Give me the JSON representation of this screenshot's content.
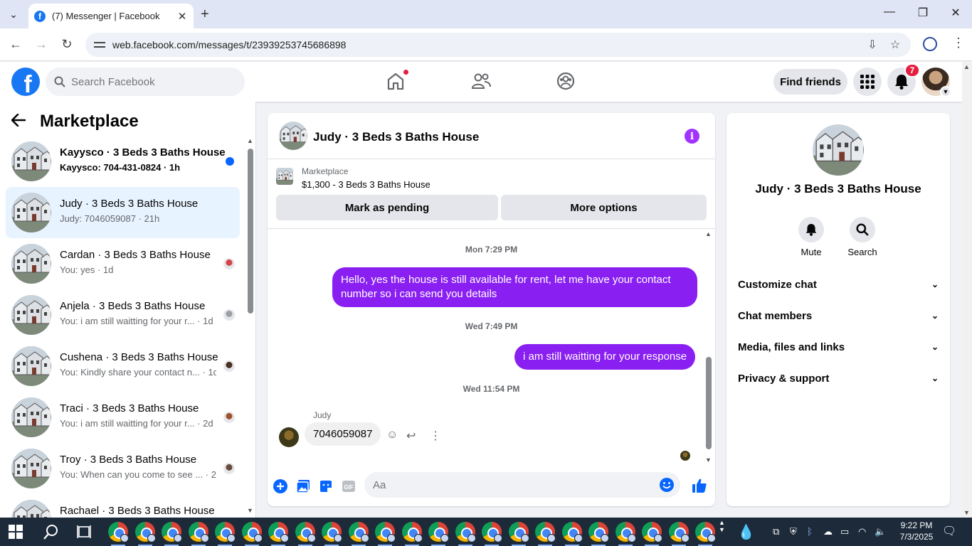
{
  "browser": {
    "tab_title": "(7) Messenger | Facebook",
    "url": "web.facebook.com/messages/t/23939253745686898"
  },
  "header": {
    "search_placeholder": "Search Facebook",
    "find_friends_label": "Find friends",
    "notification_count": "7"
  },
  "sidebar": {
    "title": "Marketplace",
    "conversations": [
      {
        "name": "Kayysco · 3 Beds 3 Baths House",
        "preview": "Kayysco: 704-431-0824 · 1h",
        "unread": true,
        "active": false
      },
      {
        "name": "Judy · 3 Beds 3 Baths House",
        "preview": "Judy: 7046059087 · 21h",
        "unread": false,
        "active": true
      },
      {
        "name": "Cardan · 3 Beds 3 Baths House",
        "preview": "You: yes · 1d",
        "unread": false,
        "active": false
      },
      {
        "name": "Anjela · 3 Beds 3 Baths House",
        "preview": "You: i am still waitting for your r... · 1d",
        "unread": false,
        "active": false
      },
      {
        "name": "Cushena · 3 Beds 3 Baths House",
        "preview": "You: Kindly share your contact n... · 1d",
        "unread": false,
        "active": false
      },
      {
        "name": "Traci · 3 Beds 3 Baths House",
        "preview": "You: i am still waitting for your r... · 2d",
        "unread": false,
        "active": false
      },
      {
        "name": "Troy · 3 Beds 3 Baths House",
        "preview": "You: When can you come to see ... · 2d",
        "unread": false,
        "active": false
      },
      {
        "name": "Rachael · 3 Beds 3 Baths House",
        "preview": "",
        "unread": false,
        "active": false
      }
    ]
  },
  "chat": {
    "title": "Judy · 3 Beds 3 Baths House",
    "marketplace_label": "Marketplace",
    "listing": "$1,300 - 3 Beds 3 Baths House",
    "mark_pending_label": "Mark as pending",
    "more_options_label": "More options",
    "messages": {
      "ts1": "Mon 7:29 PM",
      "out1": "Hello, yes the house is still available for rent, let me have your contact number so i can send you  details",
      "ts2": "Wed 7:49 PM",
      "out2": "i am still waitting for your response",
      "ts3": "Wed 11:54 PM",
      "sender": "Judy",
      "in1": "7046059087"
    },
    "composer_placeholder": "Aa",
    "accent_color": "#8a1ff2"
  },
  "details": {
    "name": "Judy · 3 Beds 3 Baths House",
    "mute_label": "Mute",
    "search_label": "Search",
    "sections": [
      "Customize chat",
      "Chat members",
      "Media, files and links",
      "Privacy & support"
    ]
  },
  "taskbar": {
    "time": "9:22 PM",
    "date": "7/3/2025"
  }
}
